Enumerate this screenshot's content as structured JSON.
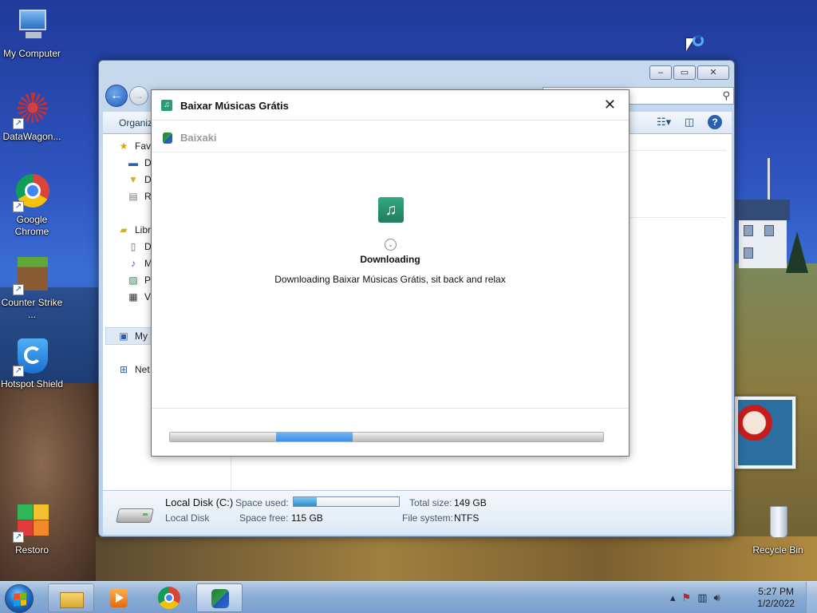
{
  "desktop": {
    "icons": [
      {
        "label": "My Computer"
      },
      {
        "label": "DataWagon..."
      },
      {
        "label": "Google Chrome"
      },
      {
        "label": "Counter Strike ..."
      },
      {
        "label": "Hotspot Shield"
      },
      {
        "label": "Restoro"
      },
      {
        "label": "Recycle Bin"
      }
    ]
  },
  "explorer": {
    "toolbar": {
      "organize": "Organiz"
    },
    "nav": {
      "favorites": "Fav",
      "fav_items": [
        "D",
        "D",
        "R"
      ],
      "libraries": "Libr",
      "lib_items": [
        "D",
        "M",
        "P",
        "V"
      ],
      "computer": "My",
      "network": "Net"
    },
    "details": {
      "drive_name": "Local Disk (C:)",
      "drive_type": "Local Disk",
      "space_used_label": "Space used:",
      "space_used_fraction": 0.22,
      "space_free_label": "Space free:",
      "space_free_value": "115 GB",
      "total_size_label": "Total size:",
      "total_size_value": "149 GB",
      "file_system_label": "File system:",
      "file_system_value": "NTFS"
    }
  },
  "dialog": {
    "title": "Baixar Músicas Grátis",
    "close": "✕",
    "brand": "Baixaki",
    "status_heading": "Downloading",
    "status_text": "Downloading Baixar Músicas Grátis, sit back and relax",
    "progress_marquee_start": 0.245,
    "progress_marquee_width": 0.176
  },
  "taskbar": {
    "clock_time": "5:27 PM",
    "clock_date": "1/2/2022"
  },
  "colors": {
    "accent": "#2b9a76",
    "progress": "#3d8fe6",
    "window_frame": "#b8cfe9"
  }
}
